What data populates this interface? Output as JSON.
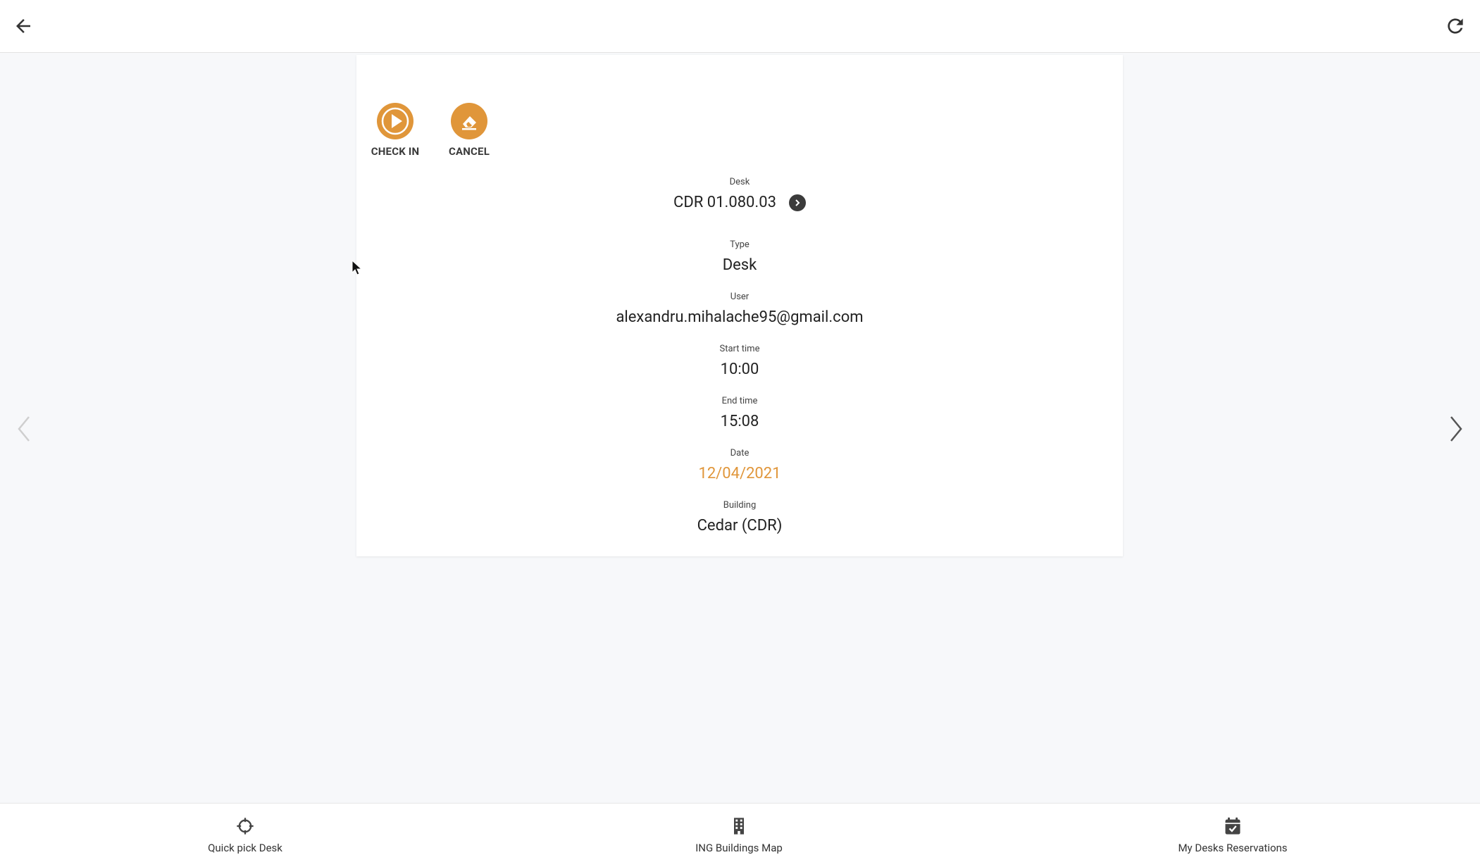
{
  "topbar": {
    "back_icon": "arrow-left-icon",
    "refresh_icon": "refresh-icon"
  },
  "actions": {
    "check_in_label": "CHECK IN",
    "cancel_label": "CANCEL"
  },
  "reservation": {
    "desk_label": "Desk",
    "desk_value": "CDR 01.080.03",
    "type_label": "Type",
    "type_value": "Desk",
    "user_label": "User",
    "user_value": "alexandru.mihalache95@gmail.com",
    "start_label": "Start time",
    "start_value": "10:00",
    "end_label": "End time",
    "end_value": "15:08",
    "date_label": "Date",
    "date_value": "12/04/2021",
    "building_label": "Building",
    "building_value": "Cedar (CDR)"
  },
  "bottom_nav": {
    "items": [
      {
        "label": "Quick pick Desk",
        "icon": "crosshair-icon"
      },
      {
        "label": "ING Buildings Map",
        "icon": "building-icon"
      },
      {
        "label": "My Desks Reservations",
        "icon": "calendar-check-icon"
      }
    ]
  },
  "colors": {
    "accent": "#e0963a",
    "text": "#222222",
    "background": "#f7f8fa"
  }
}
